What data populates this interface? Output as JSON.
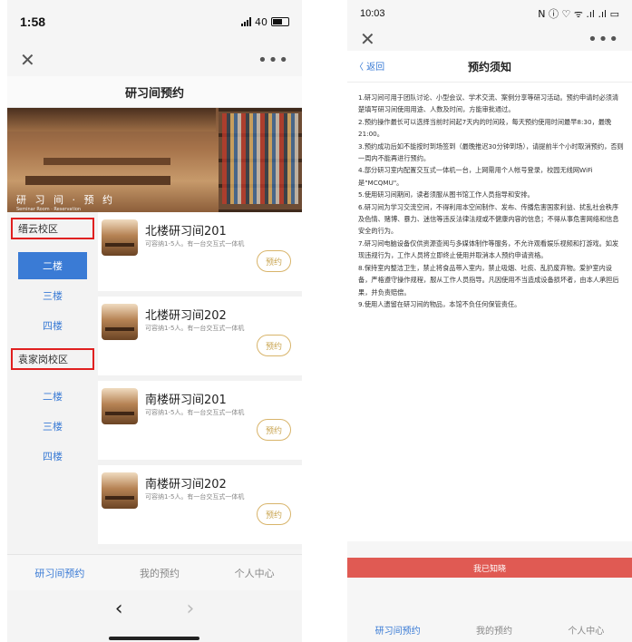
{
  "left": {
    "status_time": "1:58",
    "status_network": "40",
    "close_glyph": "✕",
    "more_glyph": "•••",
    "page_title": "研习间预约",
    "banner_caption": "研 习 间 · 预 约",
    "banner_caption_small": "Seminar Room · Reservation",
    "campuses": [
      {
        "name": "缙云校区",
        "floors": [
          "二楼",
          "三楼",
          "四楼"
        ],
        "active_floor": 0
      },
      {
        "name": "袁家岗校区",
        "floors": [
          "二楼",
          "三楼",
          "四楼"
        ]
      }
    ],
    "rooms": [
      {
        "name": "北楼研习间201",
        "desc": "可容纳1-5人。有一台交互式一体机",
        "button": "预约"
      },
      {
        "name": "北楼研习间202",
        "desc": "可容纳1-5人。有一台交互式一体机",
        "button": "预约"
      },
      {
        "name": "南楼研习间201",
        "desc": "可容纳1-5人。有一台交互式一体机",
        "button": "预约"
      },
      {
        "name": "南楼研习间202",
        "desc": "可容纳1-5人。有一台交互式一体机",
        "button": "预约"
      }
    ],
    "tabs": [
      "研习间预约",
      "我的预约",
      "个人中心"
    ],
    "nav_back": "‹",
    "nav_forward": "›"
  },
  "right": {
    "status_time": "10:03",
    "status_icons": "N ⓘ ♡ ᯤ .ıl .ıl ▭",
    "close_glyph": "✕",
    "more_glyph": "•••",
    "back_label": "〈 返回",
    "title": "预约须知",
    "rules": [
      "1.研习间可用于团队讨论、小型会议、学术交流、案例分享等研习活动。预约申请时必须清楚填写研习间使用用途、人数及时间，方能审批通过。",
      "2.预约操作最长可以选择当前时间起7天内的时间段，每天预约使用时间最早8:30，最晚21:00。",
      "3.预约成功后如不能按时到场签到（最晚推迟30分钟到场），请提前半个小时取消预约，否则一周内不能再进行预约。",
      "4.部分研习室内配置交互式一体机一台，上网需用个人帐号登录，校园无线网WiFi是\"MCQMU\"。",
      "5.使用研习间期间，读者须服从图书馆工作人员指导和安排。",
      "6.研习间为学习交流空间，不得利用本空间制作、发布、传播危害国家利益、扰乱社会秩序及色情、赌博、暴力、迷信等违反法律法规或不健康内容的信息；不得从事危害网络和信息安全的行为。",
      "7.研习间电脑设备仅供资源查阅与多媒体制作等服务，不允许观看娱乐视频和打游戏。如发现违规行为，工作人员将立即终止使用并取消本人预约申请资格。",
      "8.保持室内整洁卫生，禁止将食品带入室内，禁止吸烟、吐痰、乱扔废弃物。爱护室内设备，严格遵守操作规程，服从工作人员指导。凡因使用不当造成设备损坏者，由本人承担后果，并负责赔偿。",
      "9.使用人遗留在研习间的物品，本馆不负任何保管责任。"
    ],
    "ack_button": "我已知晓",
    "tabs": [
      "研习间预约",
      "我的预约",
      "个人中心"
    ]
  }
}
